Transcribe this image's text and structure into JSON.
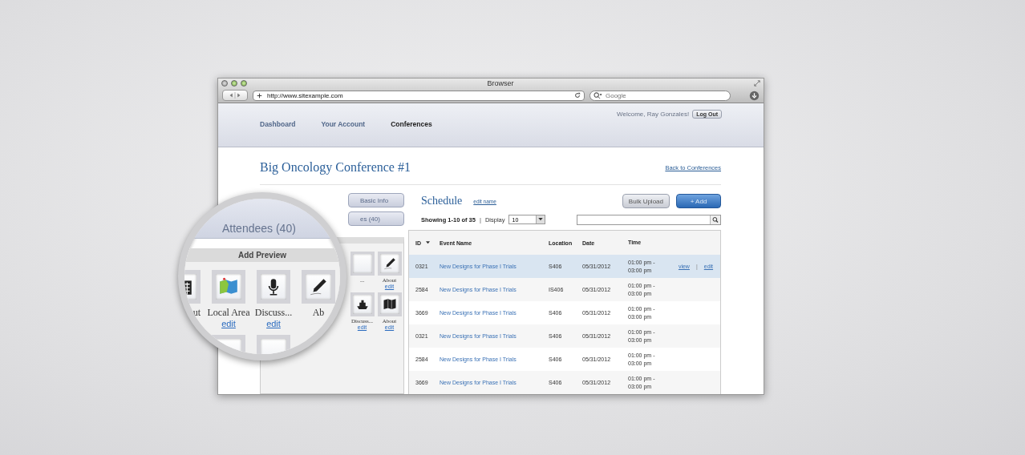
{
  "window": {
    "title": "Browser",
    "url": "http://www.sitexample.com",
    "search_placeholder": "Google"
  },
  "nav": {
    "items": [
      {
        "label": "Dashboard",
        "selected": false
      },
      {
        "label": "Your Account",
        "selected": false
      },
      {
        "label": "Conferences",
        "selected": true
      }
    ],
    "welcome": "Welcome, Ray Gonzales!",
    "logout": "Log Out"
  },
  "page": {
    "title": "Big Oncology Conference #1",
    "back_link": "Back to Conferences"
  },
  "side_tabs": [
    {
      "label": "Basic Info"
    },
    {
      "label": "es (40)"
    }
  ],
  "preview": {
    "tiles": [
      {
        "kind": "blank",
        "label": "..."
      },
      {
        "kind": "pen",
        "label": "About",
        "edit": "edit"
      },
      {
        "kind": "ship",
        "label": "Discuss...",
        "edit": "edit"
      },
      {
        "kind": "atlas",
        "label": "About",
        "edit": "edit"
      }
    ]
  },
  "schedule": {
    "title": "Schedule",
    "edit_name": "edit name",
    "buttons": [
      {
        "label": "Bulk Upload",
        "kind": "secondary"
      },
      {
        "label": "+ Add",
        "kind": "primary"
      }
    ],
    "showing": "Showing 1-10 of 35",
    "separator": "|",
    "display_label": "Display",
    "display_value": "10",
    "table": {
      "columns": [
        {
          "label": "ID",
          "sorted": true
        },
        {
          "label": "Event Name",
          "sorted": false
        },
        {
          "label": "Location",
          "sorted": false
        },
        {
          "label": "Date",
          "sorted": false
        },
        {
          "label": "Time",
          "sorted": false
        }
      ],
      "rows": [
        {
          "cells": [
            "0321",
            "New Designs for Phase I Trials",
            "S406",
            "05/31/2012",
            "01:00 pm - 03:00 pm"
          ],
          "selected": true,
          "actions": [
            "view",
            "|",
            "edit"
          ]
        },
        {
          "cells": [
            "2584",
            "New Designs for Phase I Trials",
            "IS406",
            "05/31/2012",
            "01:00 pm - 03:00 pm"
          ],
          "selected": false
        },
        {
          "cells": [
            "3669",
            "New Designs for Phase I Trials",
            "S406",
            "05/31/2012",
            "01:00 pm - 03:00 pm"
          ],
          "selected": false
        },
        {
          "cells": [
            "0321",
            "New Designs for Phase I Trials",
            "S406",
            "05/31/2012",
            "01:00 pm - 03:00 pm"
          ],
          "selected": false
        },
        {
          "cells": [
            "2584",
            "New Designs for Phase I Trials",
            "S406",
            "05/31/2012",
            "01:00 pm - 03:00 pm"
          ],
          "selected": false
        },
        {
          "cells": [
            "3669",
            "New Designs for Phase I Trials",
            "S406",
            "05/31/2012",
            "01:00 pm - 03:00 pm"
          ],
          "selected": false
        }
      ]
    }
  },
  "lens": {
    "tab": "Attendees (40)",
    "panel_title": "Add Preview",
    "tiles": [
      {
        "kind": "calendar",
        "label": "ut"
      },
      {
        "kind": "map",
        "label": "Local Area",
        "edit": "edit"
      },
      {
        "kind": "mic",
        "label": "Discuss...",
        "edit": "edit"
      },
      {
        "kind": "pen",
        "label": "Ab"
      },
      {
        "kind": "blank"
      },
      {
        "kind": "blank"
      }
    ]
  }
}
